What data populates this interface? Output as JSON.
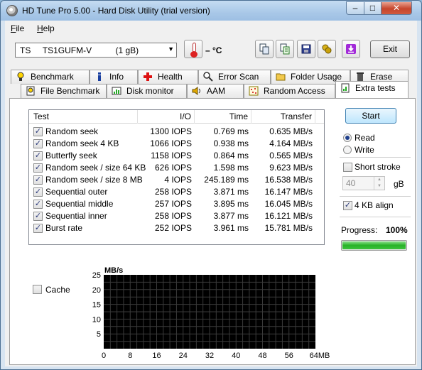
{
  "window": {
    "title": "HD Tune Pro 5.00 - Hard Disk Utility (trial version)",
    "min": "–",
    "max": "□",
    "close": "✕"
  },
  "menu": {
    "file": "File",
    "help": "Help"
  },
  "toolbar": {
    "drive": "TS     TS1GUFM-V          (1 gB)",
    "temperature": "– °C",
    "exit": "Exit",
    "icons": [
      "copy-icon",
      "copy-text-icon",
      "save-icon",
      "screenshot-icon",
      "download-icon"
    ]
  },
  "tabs_row1": [
    {
      "label": "Benchmark",
      "icon": "benchmark-icon"
    },
    {
      "label": "Info",
      "icon": "info-icon"
    },
    {
      "label": "Health",
      "icon": "health-icon"
    },
    {
      "label": "Error Scan",
      "icon": "error-scan-icon"
    },
    {
      "label": "Folder Usage",
      "icon": "folder-icon"
    },
    {
      "label": "Erase",
      "icon": "erase-icon"
    }
  ],
  "tabs_row2": [
    {
      "label": "File Benchmark",
      "icon": "file-benchmark-icon"
    },
    {
      "label": "Disk monitor",
      "icon": "disk-monitor-icon"
    },
    {
      "label": "AAM",
      "icon": "speaker-icon"
    },
    {
      "label": "Random Access",
      "icon": "random-access-icon"
    },
    {
      "label": "Extra tests",
      "icon": "extra-tests-icon"
    }
  ],
  "table": {
    "headers": [
      "Test",
      "I/O",
      "Time",
      "Transfer"
    ],
    "rows": [
      {
        "test": "Random seek",
        "io": "1300 IOPS",
        "time": "0.769 ms",
        "transfer": "0.635 MB/s",
        "checked": true
      },
      {
        "test": "Random seek 4 KB",
        "io": "1066 IOPS",
        "time": "0.938 ms",
        "transfer": "4.164 MB/s",
        "checked": true
      },
      {
        "test": "Butterfly seek",
        "io": "1158 IOPS",
        "time": "0.864 ms",
        "transfer": "0.565 MB/s",
        "checked": true
      },
      {
        "test": "Random seek / size 64 KB",
        "io": "626 IOPS",
        "time": "1.598 ms",
        "transfer": "9.623 MB/s",
        "checked": true
      },
      {
        "test": "Random seek / size 8 MB",
        "io": "4 IOPS",
        "time": "245.189 ms",
        "transfer": "16.538 MB/s",
        "checked": true
      },
      {
        "test": "Sequential outer",
        "io": "258 IOPS",
        "time": "3.871 ms",
        "transfer": "16.147 MB/s",
        "checked": true
      },
      {
        "test": "Sequential middle",
        "io": "257 IOPS",
        "time": "3.895 ms",
        "transfer": "16.045 MB/s",
        "checked": true
      },
      {
        "test": "Sequential inner",
        "io": "258 IOPS",
        "time": "3.877 ms",
        "transfer": "16.121 MB/s",
        "checked": true
      },
      {
        "test": "Burst rate",
        "io": "252 IOPS",
        "time": "3.961 ms",
        "transfer": "15.781 MB/s",
        "checked": true
      }
    ]
  },
  "controls": {
    "start": "Start",
    "read": "Read",
    "write": "Write",
    "short_stroke": "Short stroke",
    "stroke_value": "40",
    "stroke_unit": "gB",
    "align": "4 KB align",
    "progress_label": "Progress:",
    "progress_text": "100%",
    "progress": 1.0,
    "cache": "Cache"
  },
  "chart_data": {
    "type": "line",
    "ylabel": "MB/s",
    "xlabel": "",
    "y_ticks": [
      "25",
      "20",
      "15",
      "10",
      "5"
    ],
    "x_ticks": [
      "0",
      "8",
      "16",
      "24",
      "32",
      "40",
      "48",
      "56",
      "64MB"
    ],
    "xlim": [
      0,
      64
    ],
    "ylim": [
      0,
      25
    ],
    "grid": true,
    "series": []
  },
  "colors": {
    "chart_bg": "#000000",
    "grid": "#3a3a3a",
    "progress": "#27b227",
    "title_bar": "#a9c8e8"
  }
}
